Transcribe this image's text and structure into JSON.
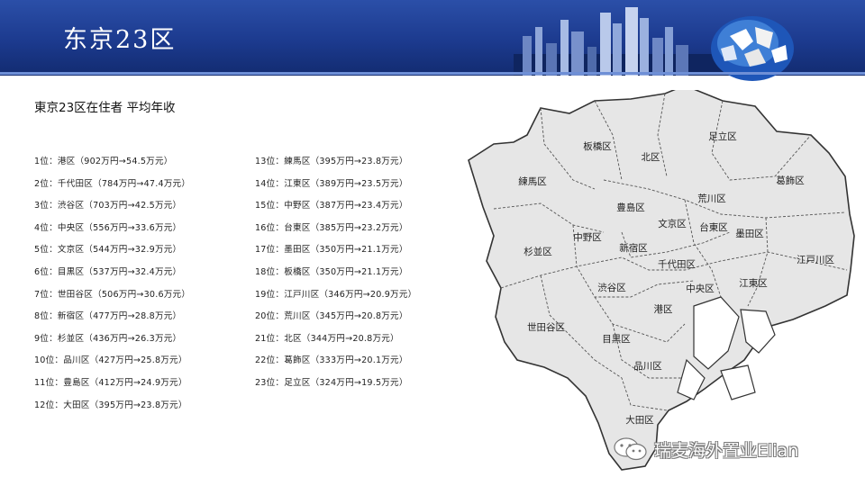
{
  "header": {
    "title": "东京23区"
  },
  "subtitle": "東京23区在住者 平均年收",
  "rankings": [
    "1位：港区（902万円→54.5万元）",
    "2位：千代田区（784万円→47.4万元）",
    "3位：渋谷区（703万円→42.5万元）",
    "4位：中央区（556万円→33.6万元）",
    "5位：文京区（544万円→32.9万元）",
    "6位：目黒区（537万円→32.4万元）",
    "7位：世田谷区（506万円→30.6万元）",
    "8位：新宿区（477万円→28.8万元）",
    "9位：杉並区（436万円→26.3万元）",
    "10位：品川区（427万円→25.8万元）",
    "11位：豊島区（412万円→24.9万元）",
    "12位：大田区（395万円→23.8万元）",
    "13位：練馬区（395万円→23.8万元）",
    "14位：江東区（389万円→23.5万元）",
    "15位：中野区（387万円→23.4万元）",
    "16位：台東区（385万円→23.2万元）",
    "17位：墨田区（350万円→21.1万元）",
    "18位：板橋区（350万円→21.1万元）",
    "19位：江戸川区（346万円→20.9万元）",
    "20位：荒川区（345万円→20.8万元）",
    "21位：北区（344万円→20.8万元）",
    "22位：葛飾区（333万円→20.1万元）",
    "23位：足立区（324万円→19.5万元）"
  ],
  "map": {
    "fill_color": "#e6e6e6",
    "border_color": "#333333",
    "ward_labels": [
      "板橋区",
      "北区",
      "足立区",
      "練馬区",
      "葛飾区",
      "荒川区",
      "豊島区",
      "文京区",
      "台東区",
      "墨田区",
      "中野区",
      "新宿区",
      "杉並区",
      "千代田区",
      "江戸川区",
      "渋谷区",
      "中央区",
      "江東区",
      "港区",
      "世田谷区",
      "目黒区",
      "品川区",
      "大田区"
    ]
  },
  "watermark": {
    "text": "瑞麦海外置业Elian",
    "icon": "wechat-icon"
  }
}
